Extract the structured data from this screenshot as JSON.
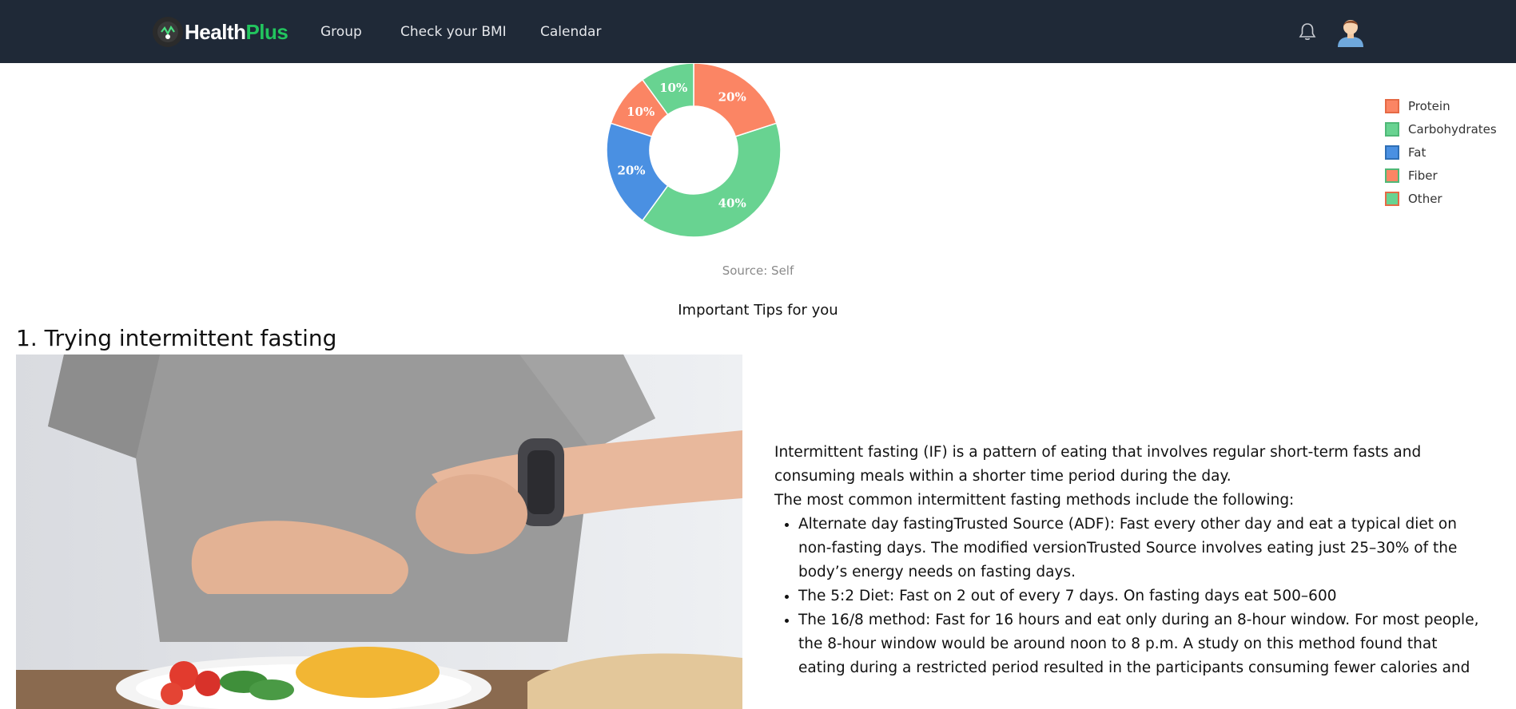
{
  "navbar": {
    "logo": {
      "health": "Health",
      "plus": "Plus"
    },
    "links": [
      "Group",
      "Check your BMI",
      "Calendar"
    ]
  },
  "chart_data": {
    "type": "pie",
    "categories": [
      "Protein",
      "Carbohydrates",
      "Fat",
      "Fiber",
      "Other"
    ],
    "values": [
      20,
      40,
      20,
      10,
      10
    ],
    "labels": [
      "20%",
      "40%",
      "20%",
      "10%",
      "10%"
    ],
    "colors": [
      "#fb8564",
      "#68d391",
      "#4a90e2",
      "#fb8564",
      "#68d391"
    ],
    "legend_position": "top-right",
    "source": "Source: Self"
  },
  "tips": {
    "title": "Important Tips for you",
    "heading": "1. Trying intermittent fasting",
    "intro": "Intermittent fasting (IF) is a pattern of eating that involves regular short-term fasts and consuming meals within a shorter time period during the day.",
    "lead": "The most common intermittent fasting methods include the following:",
    "items": [
      "Alternate day fastingTrusted Source (ADF): Fast every other day and eat a typical diet on non-fasting days. The modified versionTrusted Source involves eating just 25–30% of the body’s energy needs on fasting days.",
      "The 5:2 Diet: Fast on 2 out of every 7 days. On fasting days eat 500–600",
      "The 16/8 method: Fast for 16 hours and eat only during an 8-hour window. For most people, the 8-hour window would be around noon to 8 p.m. A study on this method found that eating during a restricted period resulted in the participants consuming fewer calories and"
    ]
  }
}
